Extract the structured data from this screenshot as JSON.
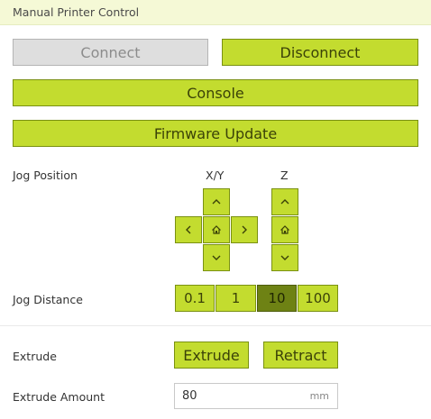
{
  "header": {
    "title": "Manual Printer Control"
  },
  "connection": {
    "connect_label": "Connect",
    "disconnect_label": "Disconnect",
    "console_label": "Console",
    "firmware_label": "Firmware Update"
  },
  "jog": {
    "position_label": "Jog Position",
    "xy_label": "X/Y",
    "z_label": "Z",
    "distance_label": "Jog Distance",
    "distances": [
      "0.1",
      "1",
      "10",
      "100"
    ],
    "selected_distance": "10"
  },
  "extrude": {
    "label": "Extrude",
    "extrude_button": "Extrude",
    "retract_button": "Retract",
    "amount_label": "Extrude Amount",
    "amount_value": "80",
    "amount_unit": "mm"
  },
  "icons": {
    "up": "chevron-up-icon",
    "down": "chevron-down-icon",
    "left": "chevron-left-icon",
    "right": "chevron-right-icon",
    "home": "home-icon"
  },
  "colors": {
    "accent": "#c3dc2f",
    "accent_border": "#7a9112",
    "active": "#6e8214",
    "disabled": "#dedede",
    "header_bg": "#f5f9d6"
  }
}
